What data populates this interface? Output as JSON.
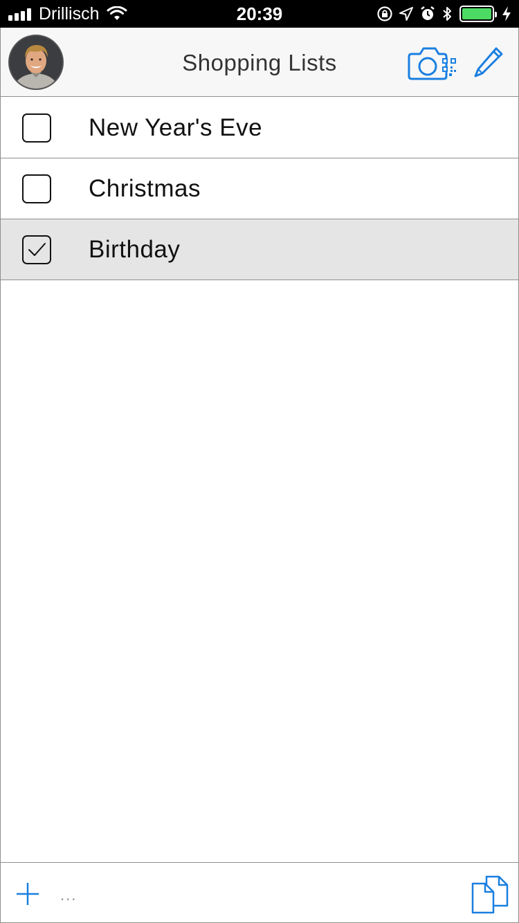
{
  "status_bar": {
    "carrier": "Drillisch",
    "time": "20:39",
    "battery_level": 1.0,
    "icons": [
      "signal-icon",
      "wifi-icon",
      "rotation-lock-icon",
      "location-icon",
      "alarm-icon",
      "bluetooth-icon",
      "battery-icon",
      "charging-icon"
    ]
  },
  "nav": {
    "title": "Shopping Lists",
    "icons": [
      "avatar",
      "camera-qr-icon",
      "pencil-icon"
    ],
    "accent_color": "#1a7fe0"
  },
  "lists": [
    {
      "label": "New Year's Eve",
      "checked": false
    },
    {
      "label": "Christmas",
      "checked": false
    },
    {
      "label": "Birthday",
      "checked": true
    }
  ],
  "toolbar": {
    "more_label": "...",
    "icons": [
      "plus-icon",
      "more-icon",
      "copy-icon"
    ]
  },
  "colors": {
    "accent": "#1a7fe0",
    "selected_row": "#e5e5e5",
    "divider": "#8e8e8e",
    "battery": "#4cd964"
  }
}
